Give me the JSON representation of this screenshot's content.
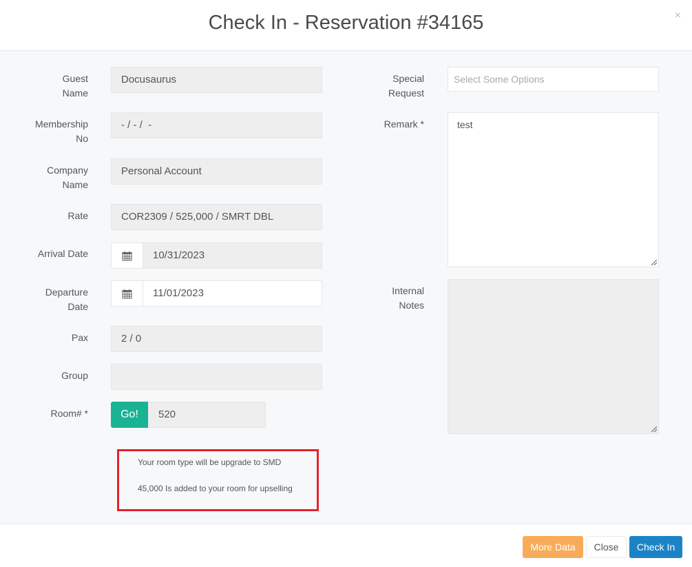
{
  "header": {
    "title": "Check In - Reservation #34165",
    "close_label": "×"
  },
  "form_left": {
    "guest_name": {
      "label1": "Guest",
      "label2": "Name",
      "value": "Docusaurus"
    },
    "membership_no": {
      "label1": "Membership",
      "label2": "No",
      "value": "- / - /  -"
    },
    "company_name": {
      "label1": "Company",
      "label2": "Name",
      "value": "Personal Account"
    },
    "rate": {
      "label": "Rate",
      "value": "COR2309 / 525,000 / SMRT DBL"
    },
    "arrival_date": {
      "label": "Arrival Date",
      "value": "10/31/2023",
      "icon": "calendar-icon"
    },
    "departure_date": {
      "label1": "Departure",
      "label2": "Date",
      "value": "11/01/2023",
      "icon": "calendar-icon"
    },
    "pax": {
      "label": "Pax",
      "value": "2 / 0"
    },
    "group": {
      "label": "Group",
      "value": ""
    },
    "room": {
      "label": "Room# *",
      "go_label": "Go!",
      "value": "520"
    }
  },
  "notice": {
    "line1": "Your room type will be upgrade to SMD",
    "line2": "45,000 Is added to your room for upselling",
    "border_color": "#e8202a"
  },
  "form_right": {
    "special_request": {
      "label1": "Special",
      "label2": "Request",
      "placeholder": "Select Some Options"
    },
    "remark": {
      "label": "Remark *",
      "value": "test"
    },
    "internal_notes": {
      "label1": "Internal",
      "label2": "Notes",
      "value": ""
    }
  },
  "footer": {
    "more_data": "More Data",
    "close": "Close",
    "check_in": "Check In"
  },
  "colors": {
    "go": "#1ab394",
    "more_data": "#f8ac59",
    "check_in": "#1c84c6"
  }
}
